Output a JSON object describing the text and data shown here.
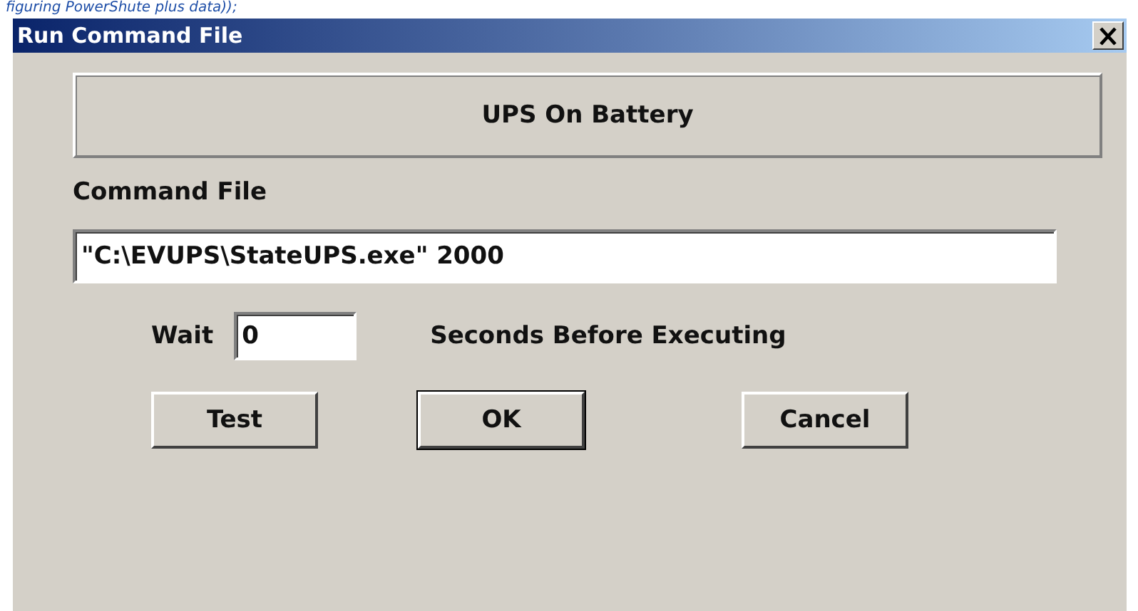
{
  "caption": "figuring PowerShute plus data));",
  "window": {
    "title": "Run Command File"
  },
  "event_panel": {
    "text": "UPS On Battery"
  },
  "command_file": {
    "label": "Command File",
    "value": "\"C:\\EVUPS\\StateUPS.exe\" 2000"
  },
  "wait": {
    "label": "Wait",
    "value": "0",
    "unit": "Seconds Before Executing"
  },
  "buttons": [
    {
      "label": "Test",
      "default": false
    },
    {
      "label": "OK",
      "default": true
    },
    {
      "label": "Cancel",
      "default": false
    }
  ]
}
